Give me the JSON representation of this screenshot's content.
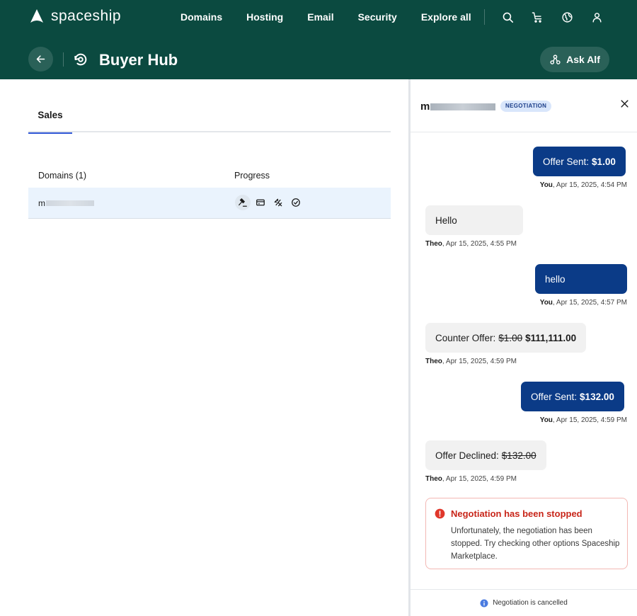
{
  "brand": {
    "name": "spaceship"
  },
  "nav": {
    "items": [
      "Domains",
      "Hosting",
      "Email",
      "Security",
      "Explore all"
    ],
    "icons": [
      "search-icon",
      "cart-icon",
      "globe-icon",
      "user-icon"
    ]
  },
  "page": {
    "title": "Buyer Hub",
    "ask_label": "Ask Alf"
  },
  "tabs": [
    {
      "label": "Sales",
      "active": true
    }
  ],
  "table": {
    "headers": [
      "Domains (1)",
      "Progress"
    ],
    "rows": [
      {
        "domain_prefix": "m",
        "progress_icons": [
          "gavel-icon",
          "card-icon",
          "transfer-icon",
          "check-circle-icon"
        ]
      }
    ]
  },
  "panel": {
    "domain_prefix": "m",
    "badge": "NEGOTIATION",
    "messages": [
      {
        "from": "you",
        "text": "Offer Sent:",
        "amount": "$1.00",
        "author": "You",
        "time": ", Apr 15, 2025, 4:54 PM"
      },
      {
        "from": "them",
        "text": "Hello",
        "author": "Theo",
        "time": ", Apr 15, 2025, 4:55 PM"
      },
      {
        "from": "you",
        "text": "hello",
        "author": "You",
        "time": ", Apr 15, 2025, 4:57 PM"
      },
      {
        "from": "them",
        "text": "Counter Offer:",
        "struck": "$1.00",
        "amount": "$111,111.00",
        "author": "Theo",
        "time": ", Apr 15, 2025, 4:59 PM"
      },
      {
        "from": "you",
        "text": "Offer Sent:",
        "amount": "$132.00",
        "author": "You",
        "time": ", Apr 15, 2025, 4:59 PM"
      },
      {
        "from": "them",
        "text": "Offer Declined:",
        "struck": "$132.00",
        "author": "Theo",
        "time": ", Apr 15, 2025, 4:59 PM"
      }
    ],
    "alert": {
      "title": "Negotiation has been stopped",
      "body": "Unfortunately, the negotiation has been stopped. Try checking other options Spaceship Marketplace."
    },
    "footer": "Negotiation is cancelled"
  },
  "colors": {
    "header_bg": "#0b4a40",
    "you_bubble": "#0b3b87",
    "them_bubble": "#f1f1f1",
    "alert_red": "#c8261a",
    "tab_accent": "#2f56d6"
  }
}
